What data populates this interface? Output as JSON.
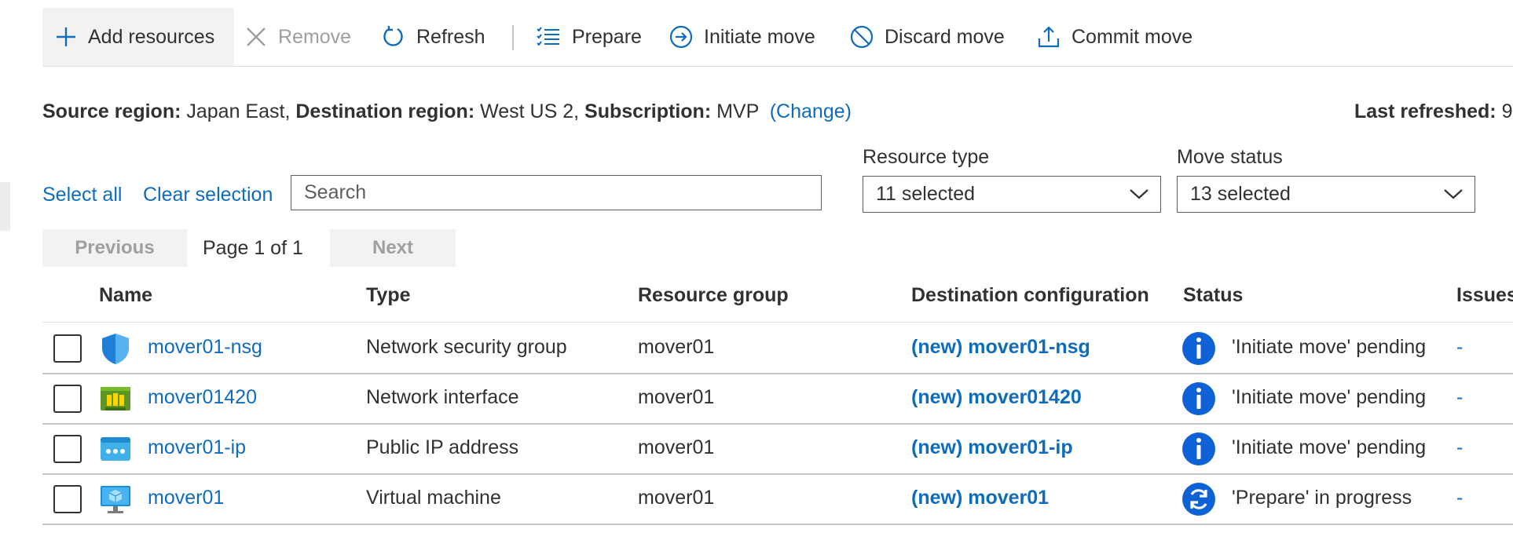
{
  "toolbar": {
    "add": "Add resources",
    "remove": "Remove",
    "refresh": "Refresh",
    "prepare": "Prepare",
    "initiate": "Initiate move",
    "discard": "Discard move",
    "commit": "Commit move"
  },
  "info": {
    "source_label": "Source region:",
    "source_value": "Japan East,",
    "dest_label": "Destination region:",
    "dest_value": "West US 2,",
    "sub_label": "Subscription:",
    "sub_value": "MVP",
    "change": "(Change)",
    "last_refreshed_label": "Last refreshed:",
    "last_refreshed_value": "9"
  },
  "filters": {
    "select_all": "Select all",
    "clear_selection": "Clear selection",
    "search_placeholder": "Search",
    "resource_type_label": "Resource type",
    "resource_type_value": "11 selected",
    "move_status_label": "Move status",
    "move_status_value": "13 selected"
  },
  "pager": {
    "previous": "Previous",
    "page": "Page 1 of 1",
    "next": "Next"
  },
  "columns": {
    "name": "Name",
    "type": "Type",
    "rg": "Resource group",
    "dest": "Destination configuration",
    "status": "Status",
    "issues": "Issues"
  },
  "rows": [
    {
      "name": "mover01-nsg",
      "type": "Network security group",
      "rg": "mover01",
      "dest": "(new) mover01-nsg",
      "status": "'Initiate move' pending",
      "issues": "-",
      "icon": "nsg-shield-icon",
      "status_icon": "info-icon"
    },
    {
      "name": "mover01420",
      "type": "Network interface",
      "rg": "mover01",
      "dest": "(new) mover01420",
      "status": "'Initiate move' pending",
      "issues": "-",
      "icon": "network-interface-icon",
      "status_icon": "info-icon"
    },
    {
      "name": "mover01-ip",
      "type": "Public IP address",
      "rg": "mover01",
      "dest": "(new) mover01-ip",
      "status": "'Initiate move' pending",
      "issues": "-",
      "icon": "public-ip-icon",
      "status_icon": "info-icon"
    },
    {
      "name": "mover01",
      "type": "Virtual machine",
      "rg": "mover01",
      "dest": "(new) mover01",
      "status": "'Prepare' in progress",
      "issues": "-",
      "icon": "virtual-machine-icon",
      "status_icon": "sync-icon"
    }
  ],
  "colors": {
    "accent": "#0f6cbd",
    "status_blue": "#0f62d6",
    "text": "#323130"
  }
}
